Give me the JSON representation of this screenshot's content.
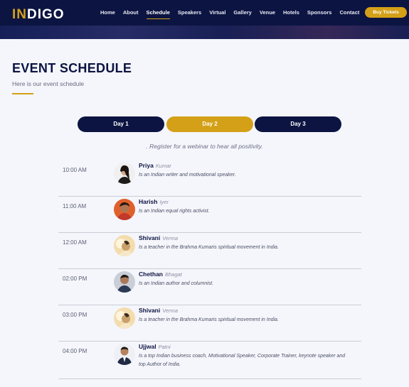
{
  "brand": {
    "logo_accent": "IN",
    "logo_rest": "DIGO"
  },
  "nav": {
    "items": [
      {
        "label": "Home"
      },
      {
        "label": "About"
      },
      {
        "label": "Schedule",
        "active": true
      },
      {
        "label": "Speakers"
      },
      {
        "label": "Virtual"
      },
      {
        "label": "Gallery"
      },
      {
        "label": "Venue"
      },
      {
        "label": "Hotels"
      },
      {
        "label": "Sponsors"
      },
      {
        "label": "Contact"
      }
    ],
    "cta": "Buy Tickets"
  },
  "page": {
    "title": "EVENT SCHEDULE",
    "subtitle": "Here is our event schedule"
  },
  "tabs": [
    {
      "label": "Day 1"
    },
    {
      "label": "Day 2",
      "active": true
    },
    {
      "label": "Day 3"
    }
  ],
  "notice": ". Register for a webinar to hear all positivity.",
  "schedule": [
    {
      "time": "10:00 AM",
      "first": "Priya",
      "last": "Kumar",
      "desc": "Is an Indian writer and motivational speaker."
    },
    {
      "time": "11:00 AM",
      "first": "Harish",
      "last": "Iyer",
      "desc": "Is an Indian equal rights activist."
    },
    {
      "time": "12:00 AM",
      "first": "Shivani",
      "last": "Verma",
      "desc": "Is a teacher in the Brahma Kumaris spiritual movement in India."
    },
    {
      "time": "02:00 PM",
      "first": "Chethan",
      "last": "Bhagat",
      "desc": "Is an Indian author and columnist."
    },
    {
      "time": "03:00 PM",
      "first": "Shivani",
      "last": "Verma",
      "desc": "Is a teacher in the Brahma Kumaris spiritual movement in India."
    },
    {
      "time": "04:00 PM",
      "first": "Ujjwal",
      "last": "Patni",
      "desc": "Is a top Indian business coach, Motivational Speaker, Corporate Trainer, keynote speaker and top Author of India."
    }
  ],
  "colors": {
    "navy": "#0c1442",
    "gold": "#d4a017",
    "background": "#f5f6fb"
  }
}
